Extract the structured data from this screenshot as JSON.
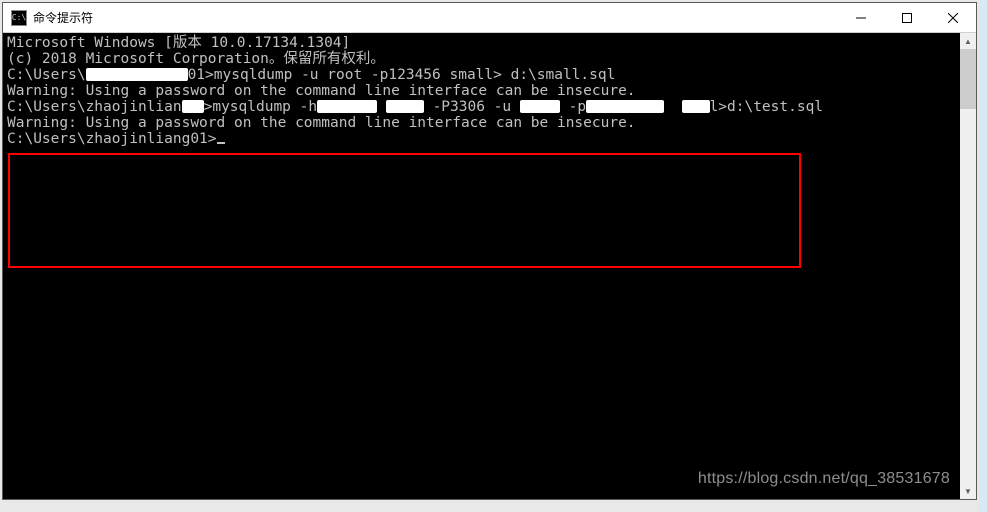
{
  "window": {
    "title": "命令提示符",
    "icon_text": "C:\\"
  },
  "terminal": {
    "lines": {
      "l0": "Microsoft Windows [版本 10.0.17134.1304]",
      "l1": "(c) 2018 Microsoft Corporation。保留所有权利。",
      "l2": "",
      "p1_prompt_a": "C:\\Users\\",
      "p1_prompt_b": "01>",
      "p1_cmd": "mysqldump -u root -p123456 small> d:\\small.sql",
      "l4": "Warning: Using a password on the command line interface can be insecure.",
      "l5": "",
      "p2_prompt_a": "C:\\Users\\zhaojinlian",
      "p2_prompt_b": ">",
      "p2_cmd_a": "mysqldump -h",
      "p2_cmd_b": " -P3306 -u ",
      "p2_cmd_c": " -p",
      "p2_cmd_d": "l>d:\\test.sql",
      "l7": "Warning: Using a password on the command line interface can be insecure.",
      "l8": "",
      "p3_prompt": "C:\\Users\\zhaojinliang01>"
    }
  },
  "watermark": "https://blog.csdn.net/qq_38531678"
}
